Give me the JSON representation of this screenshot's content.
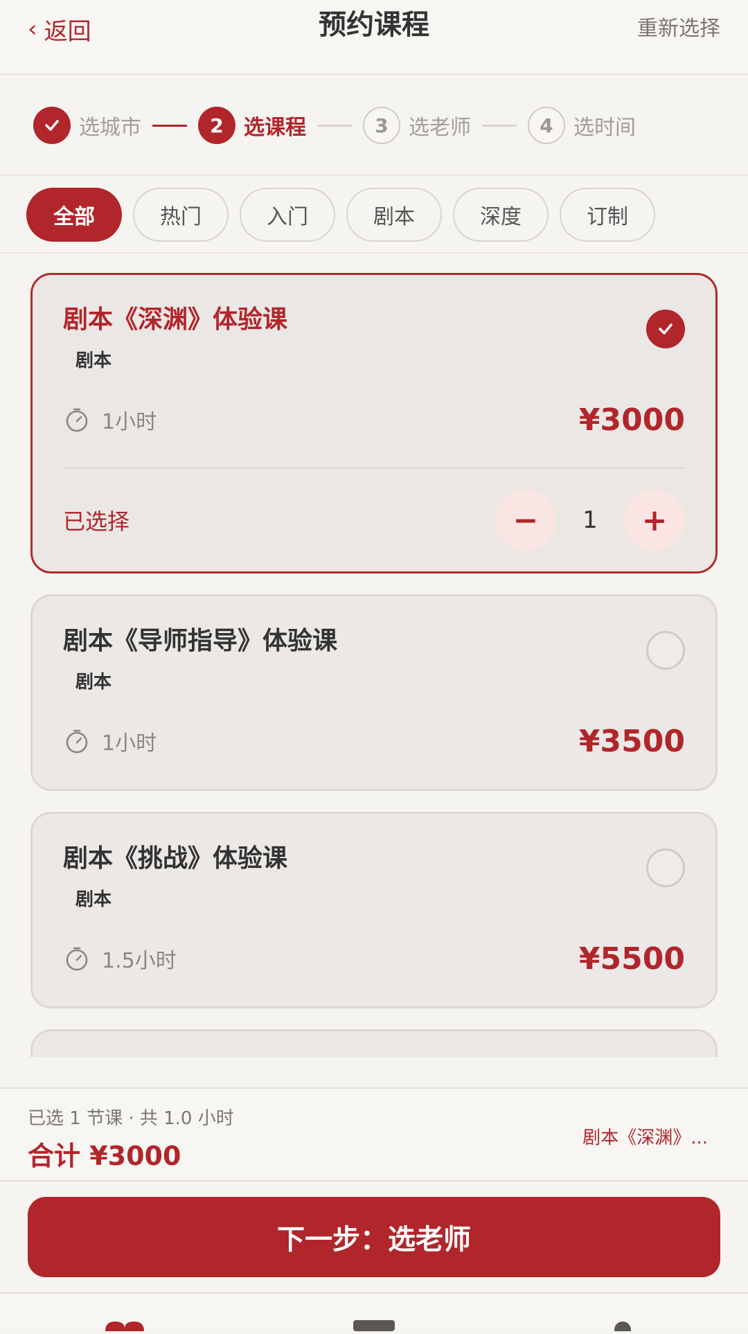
{
  "header": {
    "back_label": "返回",
    "title": "预约课程",
    "reset_label": "重新选择"
  },
  "stepper": {
    "steps": [
      {
        "num": "✓",
        "label": "选城市",
        "state": "done"
      },
      {
        "num": "2",
        "label": "选课程",
        "state": "active"
      },
      {
        "num": "3",
        "label": "选老师",
        "state": "todo"
      },
      {
        "num": "4",
        "label": "选时间",
        "state": "todo"
      }
    ]
  },
  "filters": [
    "全部",
    "热门",
    "入门",
    "剧本",
    "深度",
    "订制"
  ],
  "courses": [
    {
      "title": "剧本《深渊》体验课",
      "tag": "剧本",
      "duration": "1小时",
      "price": "¥3000",
      "selected": true,
      "selected_label": "已选择",
      "quantity": "1"
    },
    {
      "title": "剧本《导师指导》体验课",
      "tag": "剧本",
      "duration": "1小时",
      "price": "¥3500",
      "selected": false
    },
    {
      "title": "剧本《挑战》体验课",
      "tag": "剧本",
      "duration": "1.5小时",
      "price": "¥5500",
      "selected": false
    }
  ],
  "qty_controls": {
    "minus": "−",
    "plus": "+"
  },
  "summary": {
    "info": "已选 1 节课 · 共 1.0 小时",
    "total": "合计 ¥3000",
    "course": "剧本《深渊》..."
  },
  "next_button": "下一步：选老师",
  "colors": {
    "accent": "#b0262b",
    "card_bg": "#ebe8e5",
    "page_bg": "#f6f4f1"
  }
}
